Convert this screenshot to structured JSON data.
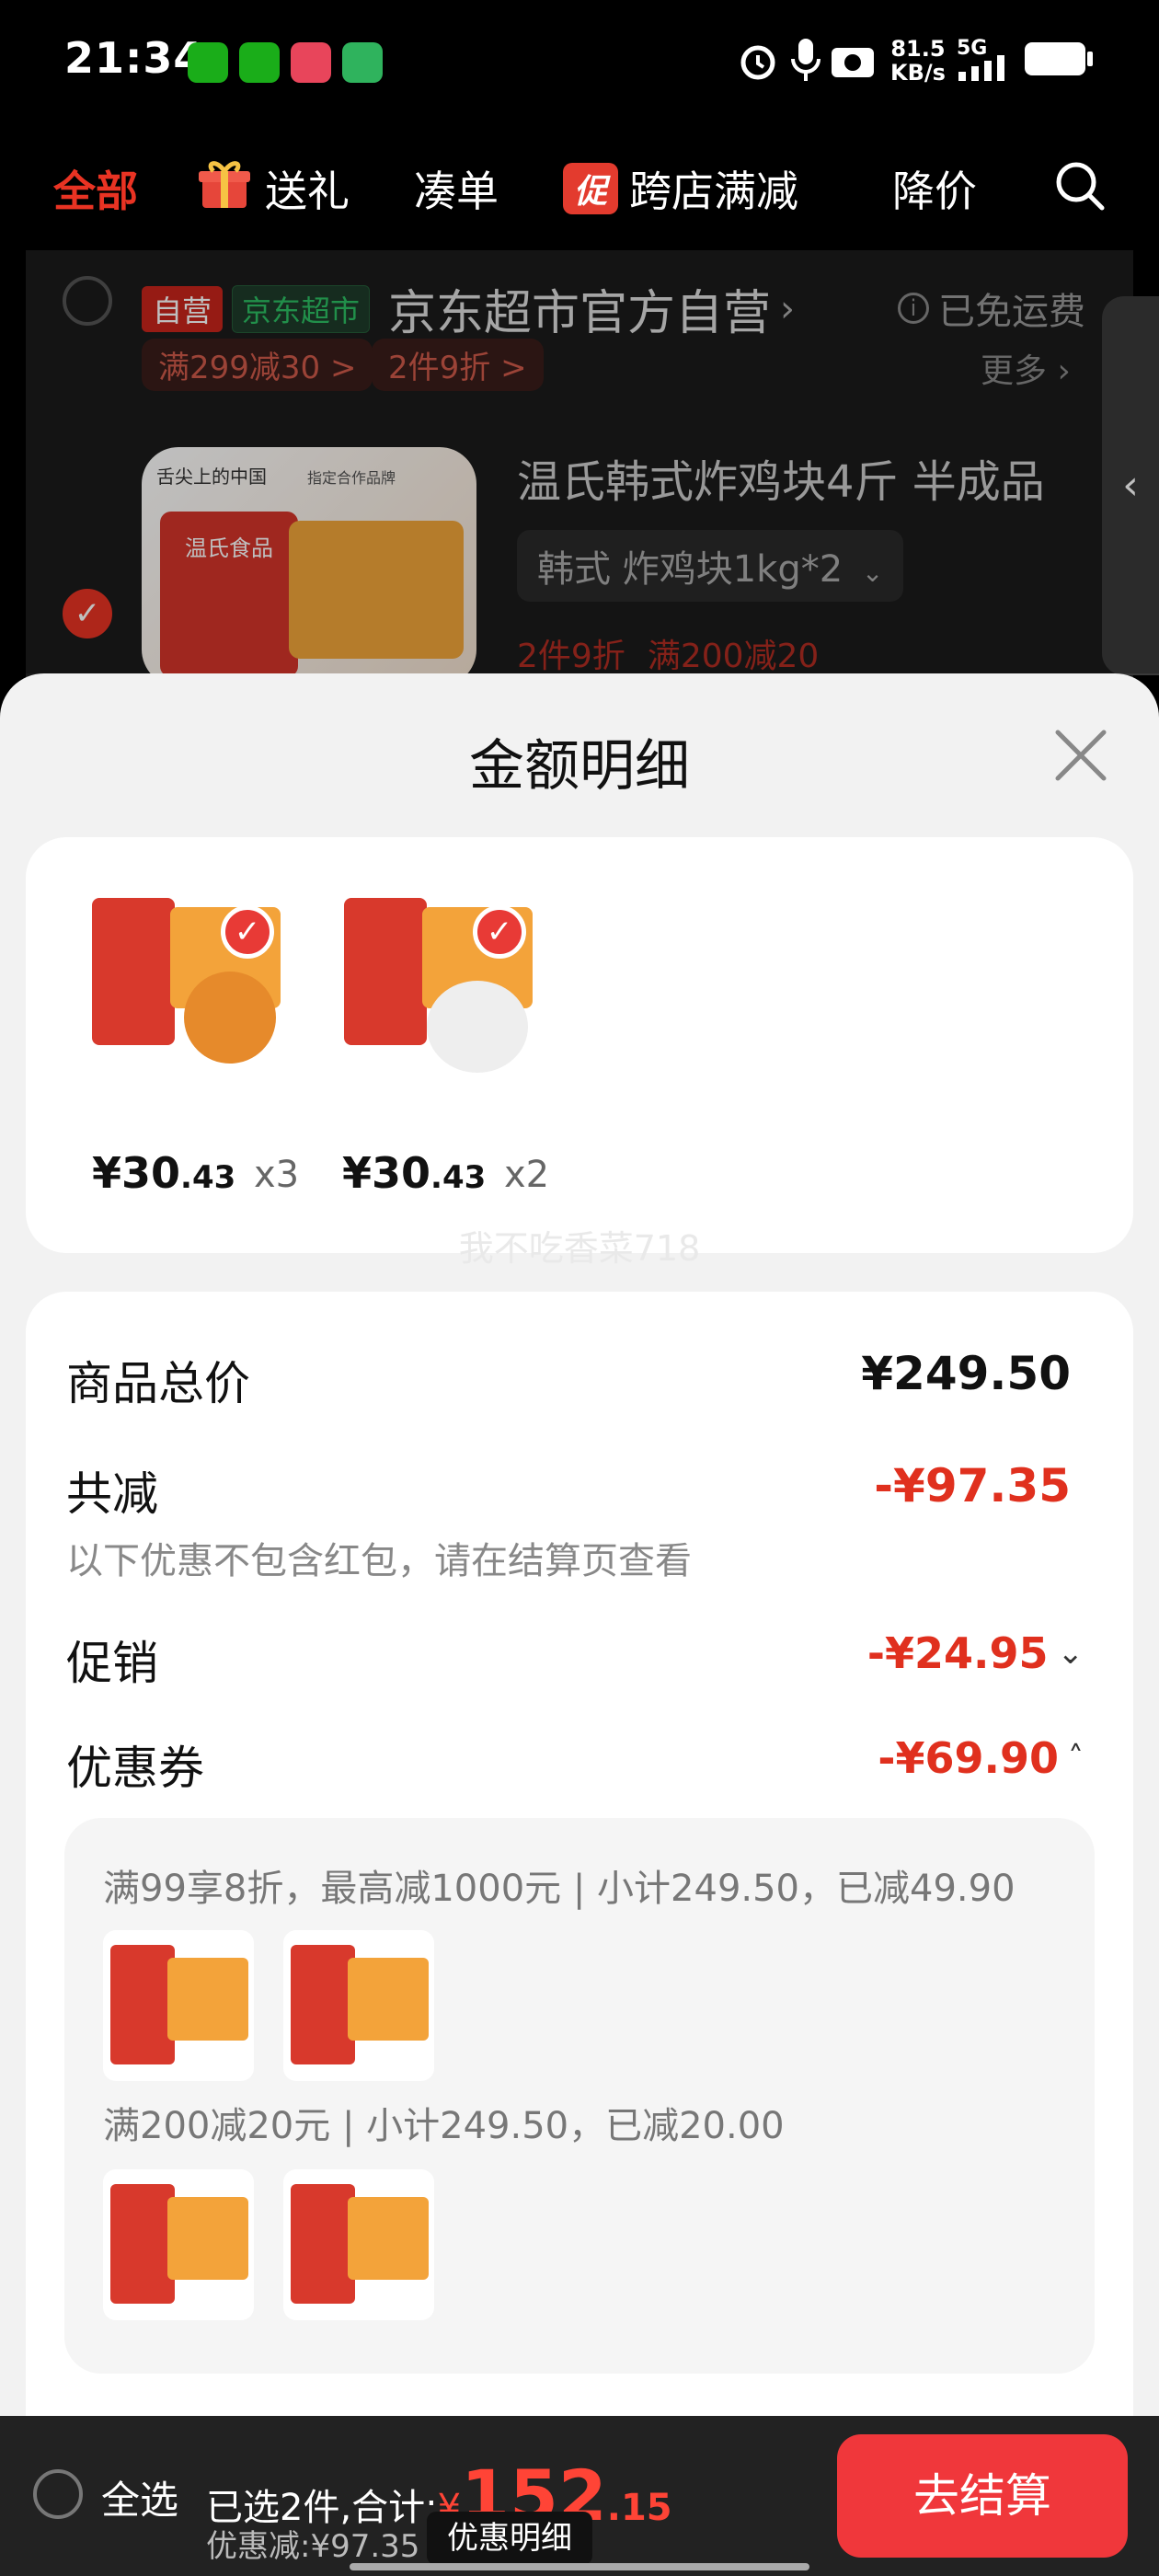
{
  "status_bar": {
    "time": "21:34",
    "net_speed": "81.5",
    "net_unit": "KB/s",
    "signal": "5G"
  },
  "tabs": [
    {
      "label": "全部",
      "active": true
    },
    {
      "label": "送礼"
    },
    {
      "label": "凑单"
    },
    {
      "label": "跨店满减",
      "badge": "促"
    },
    {
      "label": "降价"
    }
  ],
  "store": {
    "tag_self": "自营",
    "tag_jd": "京东超市",
    "name": "京东超市官方自营",
    "free_ship": "已免运费",
    "promos": [
      "满299减30 >",
      "2件9折 >"
    ],
    "more": "更多"
  },
  "cart_item": {
    "title": "温氏韩式炸鸡块4斤 半成品",
    "sku": "韩式 炸鸡块1kg*2",
    "tags": [
      "2件9折",
      "满200减20"
    ],
    "brand_text": "舌尖上的中国",
    "brand_sub": "指定合作品牌",
    "product_brand": "温氏食品"
  },
  "sheet": {
    "title": "金额明细",
    "items": [
      {
        "price_int": "¥30",
        "price_dec": ".43",
        "qty": "x3"
      },
      {
        "price_int": "¥30",
        "price_dec": ".43",
        "qty": "x2"
      }
    ],
    "watermark": "我不吃香菜718",
    "goods_total_label": "商品总价",
    "goods_total": "¥249.50",
    "total_discount_label": "共减",
    "total_discount": "-¥97.35",
    "note": "以下优惠不包含红包，请在结算页查看",
    "promo_label": "促销",
    "promo_value": "-¥24.95",
    "coupon_label": "优惠券",
    "coupon_value": "-¥69.90",
    "coupons": [
      {
        "text": "满99享8折，最高减1000元 | 小计249.50，已减49.90"
      },
      {
        "text": "满200减20元 | 小计249.50，已减20.00"
      }
    ]
  },
  "bottom": {
    "select_all": "全选",
    "selected_text": "已选2件,合计:",
    "currency": "¥",
    "total_int": "152",
    "total_dec": ".15",
    "discount_text": "优惠减:¥97.35",
    "detail_button": "优惠明细",
    "checkout_button": "去结算"
  },
  "colors": {
    "accent": "#e93323",
    "checkout": "#f0373b"
  }
}
